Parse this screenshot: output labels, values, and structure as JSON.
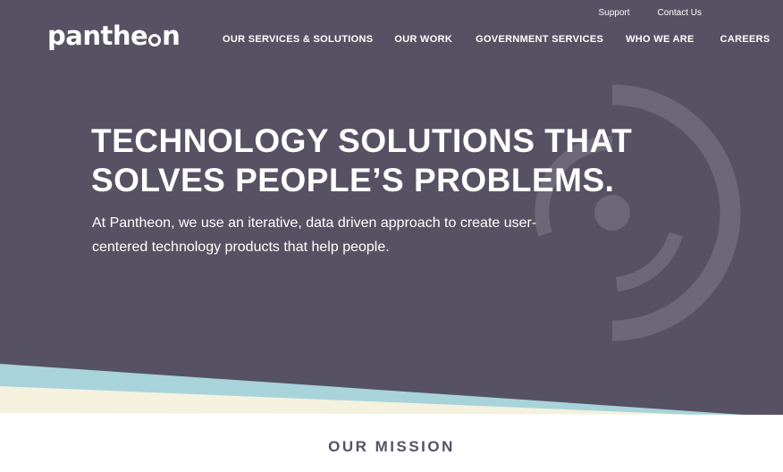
{
  "brand": {
    "logo_text_pre": "panthe",
    "logo_text_post": "n"
  },
  "utility_nav": [
    {
      "label": "Support"
    },
    {
      "label": "Contact Us"
    }
  ],
  "main_nav": [
    {
      "label": "OUR SERVICES & SOLUTIONS"
    },
    {
      "label": "OUR WORK"
    },
    {
      "label": "GOVERNMENT SERVICES"
    },
    {
      "label": "WHO WE ARE"
    },
    {
      "label": "CAREERS"
    }
  ],
  "hero": {
    "title_line1": "TECHNOLOGY SOLUTIONS THAT",
    "title_line2": "SOLVES PEOPLE’S PROBLEMS.",
    "subtitle": "At Pantheon, we use an iterative, data driven approach to create user-centered technology products that help people."
  },
  "mission": {
    "heading": "OUR MISSION"
  },
  "colors": {
    "hero_bg": "#565263",
    "ring": "#6c6877",
    "teal_band": "#a8d3db",
    "cream_band": "#f4f1df",
    "text_white": "#ffffff"
  }
}
